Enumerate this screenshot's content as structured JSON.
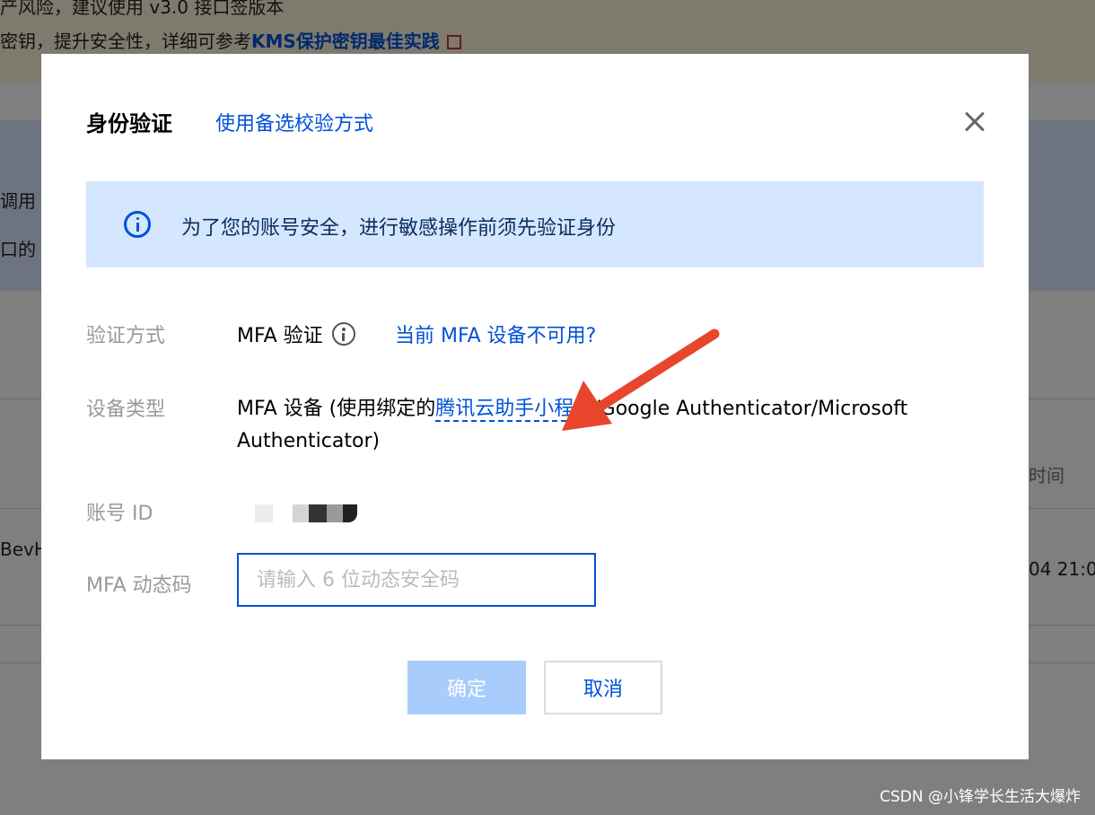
{
  "background": {
    "banner_line1": "产风险，建议使用 v3.0 接口签版本",
    "banner_line2_prefix": "密钥，提升安全性，详细可参考",
    "banner_line2_link": "KMS保护密钥最佳实践",
    "info_line1": "调用",
    "info_line2": "口的",
    "table_header_time": "时间",
    "table_row_id": "BevH",
    "table_row_time": "04 21:0"
  },
  "modal": {
    "title": "身份验证",
    "alt_method_link": "使用备选校验方式",
    "notice": "为了您的账号安全，进行敏感操作前须先验证身份",
    "method_label": "验证方式",
    "method_value": "MFA 验证",
    "mfa_unavailable_link": "当前 MFA 设备不可用?",
    "device_label": "设备类型",
    "device_value_prefix": "MFA 设备 (使用绑定的",
    "device_value_link": "腾讯云助手小程序",
    "device_value_suffix": "/Google Authenticator/Microsoft Authenticator)",
    "account_label": "账号 ID",
    "code_label": "MFA 动态码",
    "code_placeholder": "请输入 6 位动态安全码",
    "confirm_button": "确定",
    "cancel_button": "取消"
  },
  "watermark": "CSDN @小锋学长生活大爆炸",
  "colors": {
    "link": "#0052d9",
    "notice_bg": "#d5e7ff",
    "confirm_disabled": "#a8cdfd",
    "annotation_arrow": "#e8452d"
  },
  "icons": {
    "close": "close-icon",
    "notice": "info-circle-icon",
    "method_help": "info-circle-icon",
    "external": "external-link-icon"
  }
}
